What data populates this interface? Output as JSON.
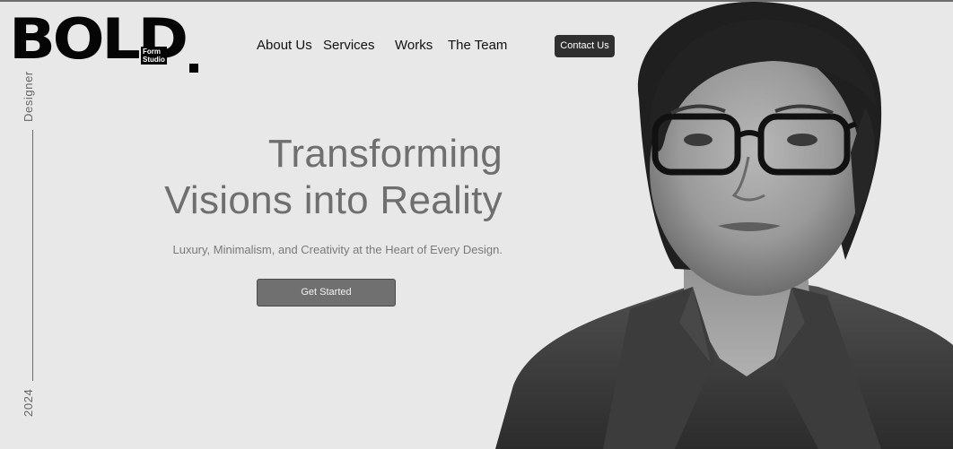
{
  "brand": {
    "wordmark": "BOLD",
    "sub_line1": "Form",
    "sub_line2": "Studio"
  },
  "nav": {
    "items": [
      "About Us",
      "Services",
      "Works",
      "The Team"
    ],
    "contact_label": "Contact Us"
  },
  "side": {
    "top_label": "Designer",
    "bottom_label": "2024"
  },
  "hero": {
    "line1": "Transforming",
    "line2": "Visions into Reality",
    "subtitle": "Luxury, Minimalism, and Creativity at the Heart of Every Design.",
    "cta_label": "Get Started"
  },
  "portrait": {
    "description_icon": "person-portrait"
  },
  "colors": {
    "background": "#e8e8e8",
    "text_dark": "#111111",
    "hero_text": "#6f6f6f",
    "button_dark": "#2f2f2f",
    "cta_gray": "#707070"
  }
}
